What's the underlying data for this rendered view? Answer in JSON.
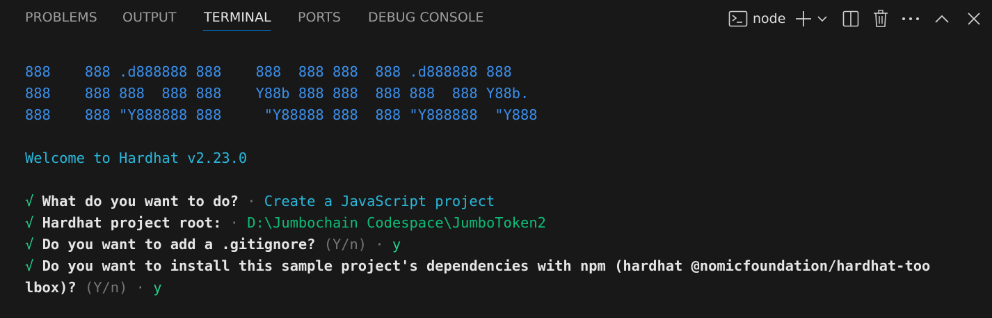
{
  "tabs": [
    {
      "label": "PROBLEMS"
    },
    {
      "label": "OUTPUT"
    },
    {
      "label": "TERMINAL"
    },
    {
      "label": "PORTS"
    },
    {
      "label": "DEBUG CONSOLE"
    }
  ],
  "active_tab": "TERMINAL",
  "terminal_name": "node",
  "icons": [
    "terminal-icon",
    "plus-icon",
    "chevron-down-icon",
    "split-icon",
    "trash-icon",
    "ellipsis-icon",
    "chevron-up-icon",
    "close-icon"
  ],
  "colors": {
    "background": "#181818",
    "accent": "#0078d4",
    "ascii_blue": "#3b8eea",
    "cyan": "#29b8db",
    "green": "#23d18b"
  },
  "terminal": {
    "ascii": [
      "888    888 .d888888 888    888  888 888  888 .d888888 888",
      "888    888 888  888 888    Y88b 888 888  888 888  888 Y88b.",
      "888    888 \"Y888888 888     \"Y88888 888  888 \"Y888888  \"Y888"
    ],
    "welcome": "Welcome to Hardhat v2.23.0",
    "check": "√",
    "dot": "·",
    "q1": {
      "question": "What do you want to do?",
      "answer": "Create a JavaScript project"
    },
    "q2": {
      "question": "Hardhat project root:",
      "answer": "D:\\Jumbochain Codespace\\JumboToken2"
    },
    "q3": {
      "question": "Do you want to add a .gitignore?",
      "hint": "(Y/n)",
      "answer": "y"
    },
    "q4": {
      "question_line1": "Do you want to install this sample project's dependencies with npm (hardhat @nomicfoundation/hardhat-too",
      "question_line2": "lbox)?",
      "hint": "(Y/n)",
      "answer": "y"
    }
  }
}
